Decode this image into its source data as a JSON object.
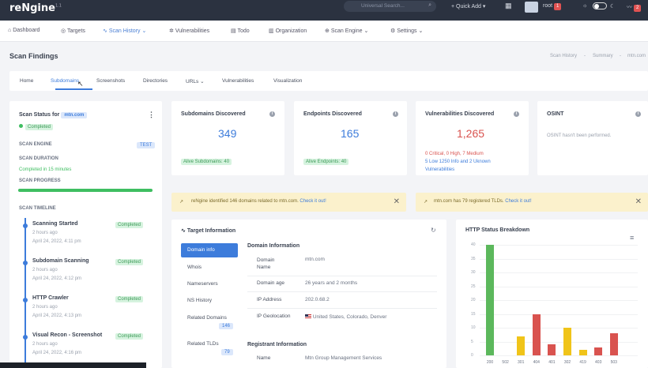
{
  "app": {
    "name": "reNgine",
    "version": "1.1"
  },
  "topbar": {
    "search_placeholder": "Universal Search...",
    "quick_add": "Quick Add",
    "user": "root",
    "user_badge": "1",
    "notif_badge": "2"
  },
  "nav": {
    "items": [
      {
        "label": "Dashboard",
        "icon": "home-icon"
      },
      {
        "label": "Targets",
        "icon": "target-icon"
      },
      {
        "label": "Scan History",
        "icon": "activity-icon"
      },
      {
        "label": "Vulnerabilities",
        "icon": "bug-icon"
      },
      {
        "label": "Todo",
        "icon": "clipboard-icon"
      },
      {
        "label": "Organization",
        "icon": "building-icon"
      },
      {
        "label": "Scan Engine",
        "icon": "globe-icon"
      },
      {
        "label": "Settings",
        "icon": "gear-icon"
      }
    ]
  },
  "page": {
    "title": "Scan Findings",
    "breadcrumb": [
      "Scan History",
      "Summary",
      "mtn.com"
    ]
  },
  "tabs": [
    "Home",
    "Subdomains",
    "Screenshots",
    "Directories",
    "URLs",
    "Vulnerabilities",
    "Visualization"
  ],
  "scan_status": {
    "title": "Scan Status for",
    "domain": "mtn.com",
    "status": "Completed",
    "engine_label": "SCAN ENGINE",
    "engine": "TEST",
    "duration_label": "SCAN DURATION",
    "duration": "Completed in 15 minutes",
    "progress_label": "SCAN PROGRESS",
    "progress_percent": 100,
    "timeline_label": "SCAN TIMELINE",
    "timeline": [
      {
        "title": "Scanning Started",
        "ago": "2 hours ago",
        "date": "April 24, 2022, 4:11 pm",
        "status": "Completed"
      },
      {
        "title": "Subdomain Scanning",
        "ago": "2 hours ago",
        "date": "April 24, 2022, 4:12 pm",
        "status": "Completed"
      },
      {
        "title": "HTTP Crawler",
        "ago": "2 hours ago",
        "date": "April 24, 2022, 4:13 pm",
        "status": "Completed"
      },
      {
        "title": "Visual Recon - Screenshot",
        "ago": "2 hours ago",
        "date": "April 24, 2022, 4:16 pm",
        "status": "Completed"
      }
    ]
  },
  "stats": {
    "subdomains": {
      "title": "Subdomains Discovered",
      "value": "349",
      "sub": "Alive Subdomains: 40"
    },
    "endpoints": {
      "title": "Endpoints Discovered",
      "value": "165",
      "sub": "Alive Endpoints: 40"
    },
    "vulns": {
      "title": "Vulnerabilities Discovered",
      "value": "1,265",
      "line1": "0 Critical, 0 High, 7 Medium",
      "line2": "5 Low 1250 Info and 2 Uknown",
      "line3": "Vulnerabilities"
    },
    "osint": {
      "title": "OSINT",
      "text": "OSINT hasn't been performed."
    }
  },
  "alerts": [
    {
      "text": "reNgine identified 146 domains related to mtn.com.",
      "link": "Check it out!"
    },
    {
      "text": "mtn.com has 79 registered TLDs.",
      "link": "Check it out!"
    }
  ],
  "target_info": {
    "title": "Target Information",
    "side": [
      {
        "label": "Domain info"
      },
      {
        "label": "Whois"
      },
      {
        "label": "Nameservers"
      },
      {
        "label": "NS History"
      },
      {
        "label": "Related Domains",
        "count": "146"
      },
      {
        "label": "Related TLDs",
        "count": "79"
      }
    ],
    "domain_section": "Domain Information",
    "rows": [
      {
        "label": "Domain Name",
        "value": "mtn.com"
      },
      {
        "label": "Domain age",
        "value": "26 years and 2 months"
      },
      {
        "label": "IP Address",
        "value": "202.0.68.2"
      },
      {
        "label": "IP Geolocation",
        "value": "United States, Colorado, Denver"
      }
    ],
    "registrant_section": "Registrant Information",
    "registrant_rows": [
      {
        "label": "Name",
        "value": "Mtn Group Management Services"
      }
    ]
  },
  "chart_data": {
    "type": "bar",
    "title": "HTTP Status Breakdown",
    "categories": [
      "200",
      "502",
      "301",
      "404",
      "401",
      "302",
      "419",
      "403",
      "503"
    ],
    "values": [
      40,
      0,
      7,
      0,
      15,
      4,
      10,
      2,
      3,
      8
    ],
    "ylim": [
      0,
      40
    ],
    "yticks": [
      0,
      5,
      10,
      15,
      20,
      25,
      30,
      35,
      40
    ],
    "colors": {
      "200": "#5cb85c",
      "3xx": "#f0c419",
      "4xx": "#d9534f"
    }
  }
}
